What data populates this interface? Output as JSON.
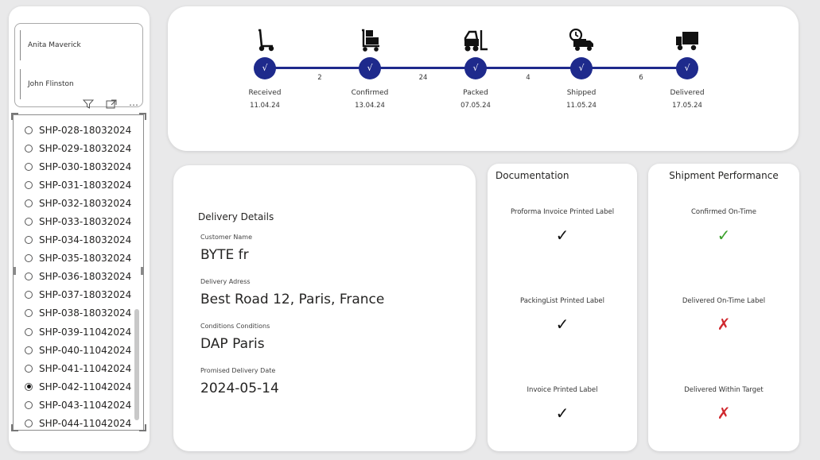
{
  "slicer": {
    "people": [
      "Anita Maverick",
      "John Flinston"
    ],
    "header_icons": [
      "filter-icon",
      "focus-mode-icon",
      "more-options-icon"
    ],
    "more_glyph": "⋯",
    "shipments": [
      "SHP-028-18032024",
      "SHP-029-18032024",
      "SHP-030-18032024",
      "SHP-031-18032024",
      "SHP-032-18032024",
      "SHP-033-18032024",
      "SHP-034-18032024",
      "SHP-035-18032024",
      "SHP-036-18032024",
      "SHP-037-18032024",
      "SHP-038-18032024",
      "SHP-039-11042024",
      "SHP-040-11042024",
      "SHP-041-11042024",
      "SHP-042-11042024",
      "SHP-043-11042024",
      "SHP-044-11042024"
    ],
    "selected": "SHP-042-11042024"
  },
  "timeline": {
    "accent": "#1e2a8c",
    "check_glyph": "√",
    "stages": [
      {
        "label": "Received",
        "date": "11.04.24",
        "icon": "hand-truck-icon"
      },
      {
        "label": "Confirmed",
        "date": "13.04.24",
        "icon": "boxes-dolly-icon"
      },
      {
        "label": "Packed",
        "date": "07.05.24",
        "icon": "forklift-icon"
      },
      {
        "label": "Shipped",
        "date": "11.05.24",
        "icon": "delivery-truck-clock-icon"
      },
      {
        "label": "Delivered",
        "date": "17.05.24",
        "icon": "truck-icon"
      }
    ],
    "gaps": [
      "2",
      "24",
      "4",
      "6"
    ]
  },
  "delivery": {
    "title": "Delivery Details",
    "fields": [
      {
        "label": "Customer Name",
        "value": "BYTE fr"
      },
      {
        "label": "Delivery Adress",
        "value": "Best Road 12, Paris, France"
      },
      {
        "label": "Conditions Conditions",
        "value": "DAP Paris"
      },
      {
        "label": "Promised Delivery Date",
        "value": "2024-05-14"
      }
    ]
  },
  "documentation": {
    "title": "Documentation",
    "items": [
      {
        "label": "Proforma Invoice Printed Label",
        "mark": "✓",
        "color": "#111111"
      },
      {
        "label": "PackingList Printed Label",
        "mark": "✓",
        "color": "#111111"
      },
      {
        "label": "Invoice Printed Label",
        "mark": "✓",
        "color": "#111111"
      }
    ]
  },
  "performance": {
    "title": "Shipment Performance",
    "items": [
      {
        "label": "Confirmed On-Time",
        "mark": "✓",
        "color": "#3aa02a"
      },
      {
        "label": "Delivered On-Time Label",
        "mark": "✗",
        "color": "#d0292f"
      },
      {
        "label": "Delivered Within Target",
        "mark": "✗",
        "color": "#d0292f"
      }
    ]
  }
}
